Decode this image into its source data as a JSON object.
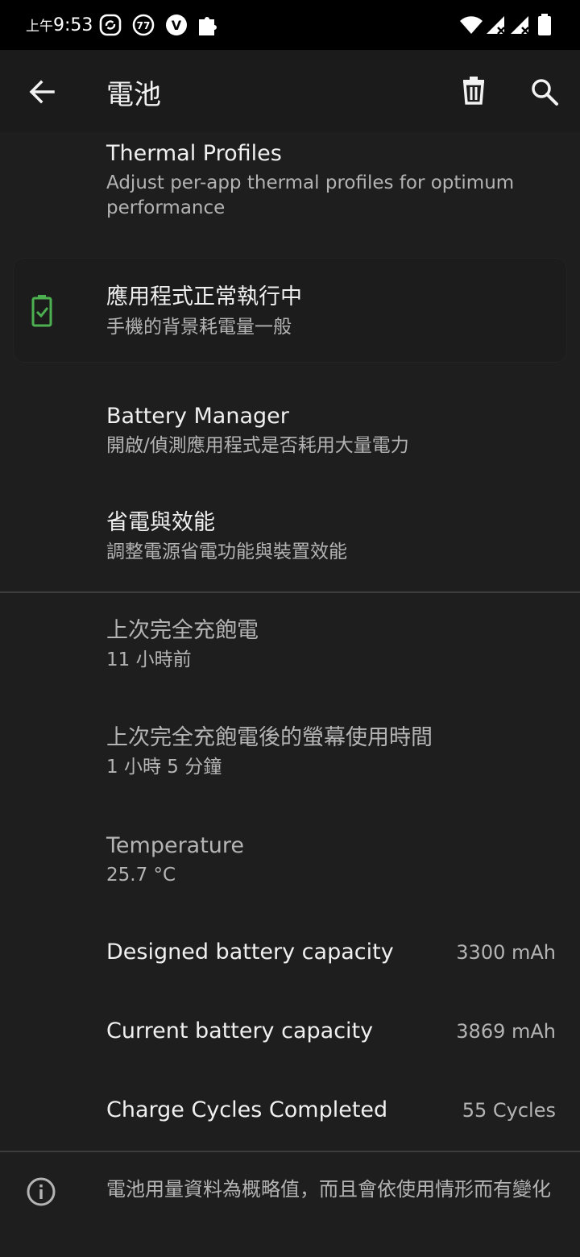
{
  "status_bar": {
    "ampm": "上午",
    "time": "9:53",
    "badge_number": "77",
    "badge_letter": "V"
  },
  "app_bar": {
    "title": "電池"
  },
  "thermal": {
    "title": "Thermal Profiles",
    "subtitle": "Adjust per-app thermal profiles for optimum performance"
  },
  "status_card": {
    "title": "應用程式正常執行中",
    "subtitle": "手機的背景耗電量一般",
    "icon_color": "#4caf50"
  },
  "battery_manager": {
    "title": "Battery Manager",
    "subtitle": "開啟/偵測應用程式是否耗用大量電力"
  },
  "power_saving": {
    "title": "省電與效能",
    "subtitle": "調整電源省電功能與裝置效能"
  },
  "last_full_charge": {
    "title": "上次完全充飽電",
    "value": "11 小時前"
  },
  "screen_time": {
    "title": "上次完全充飽電後的螢幕使用時間",
    "value": "1 小時 5 分鐘"
  },
  "temperature": {
    "title": "Temperature",
    "value": "25.7 °C"
  },
  "designed_capacity": {
    "label": "Designed battery capacity",
    "value": "3300 mAh"
  },
  "current_capacity": {
    "label": "Current battery capacity",
    "value": "3869 mAh"
  },
  "charge_cycles": {
    "label": "Charge Cycles Completed",
    "value": "55 Cycles"
  },
  "footer": {
    "text": "電池用量資料為概略值，而且會依使用情形而有變化"
  }
}
